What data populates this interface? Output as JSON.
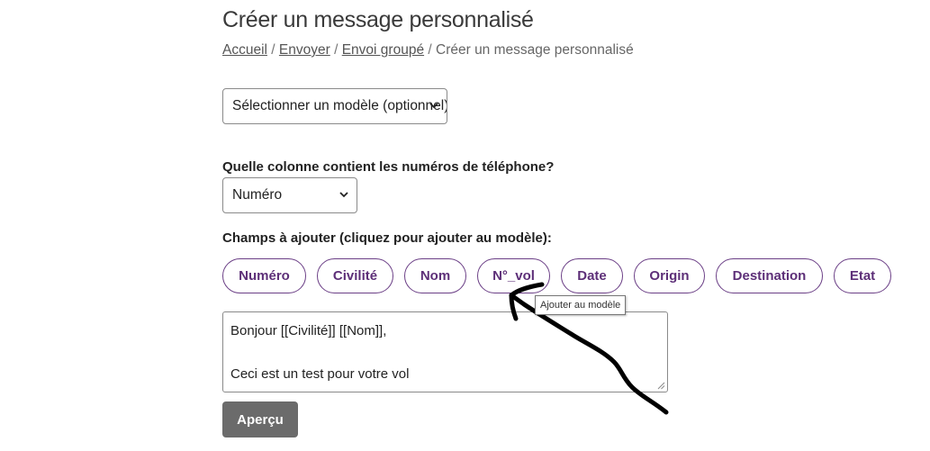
{
  "page": {
    "title": "Créer un message personnalisé"
  },
  "breadcrumb": {
    "items": [
      {
        "label": "Accueil"
      },
      {
        "label": "Envoyer"
      },
      {
        "label": "Envoi groupé"
      }
    ],
    "separator": "/",
    "current": "Créer un message personnalisé"
  },
  "template_select": {
    "value": "Sélectionner un modèle (optionnel)"
  },
  "phone_column": {
    "label": "Quelle colonne contient les numéros de téléphone?",
    "value": "Numéro"
  },
  "fields": {
    "label": "Champs à ajouter (cliquez pour ajouter au modèle):",
    "chips": [
      {
        "label": "Numéro"
      },
      {
        "label": "Civilité"
      },
      {
        "label": "Nom"
      },
      {
        "label": "N°_vol"
      },
      {
        "label": "Date"
      },
      {
        "label": "Origin"
      },
      {
        "label": "Destination"
      },
      {
        "label": "Etat"
      }
    ],
    "tooltip": "Ajouter au modèle"
  },
  "message": {
    "lines": [
      "Bonjour [[Civilité]] [[Nom]],",
      "",
      "Ceci est un test pour votre vol"
    ]
  },
  "actions": {
    "preview_label": "Aperçu"
  },
  "colors": {
    "chip_border": "#6b3f86",
    "chip_text": "#5d2f78",
    "button_bg": "#6b6b6b",
    "annotation_arrow": "#000000"
  },
  "icons": {
    "select_chevron": "chevron-down-icon",
    "textarea_resize": "resize-grip-icon",
    "annotation": "hand-drawn-arrow"
  }
}
